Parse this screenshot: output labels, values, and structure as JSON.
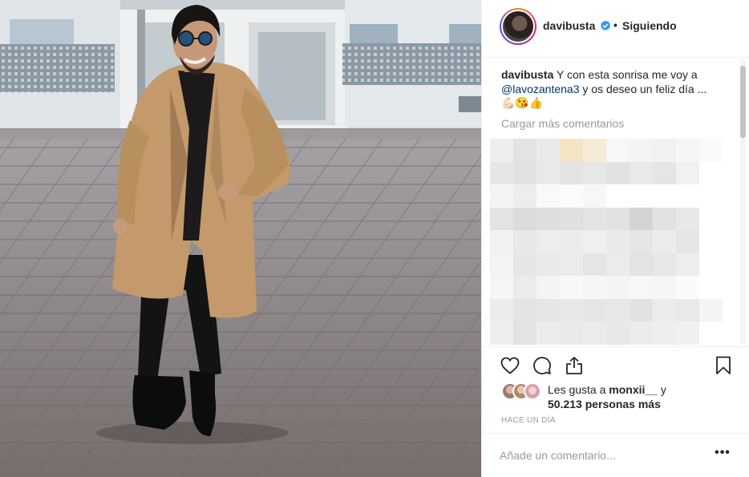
{
  "post": {
    "username": "davibusta",
    "follow_status": "Siguiendo",
    "separator": "•",
    "caption": {
      "user": "davibusta",
      "text_before": "Y con esta sonrisa me voy a",
      "mention": "@lavozantena3",
      "text_after": "y os deseo un feliz día ...",
      "emojis": "💪🏻😘👍"
    },
    "load_more_comments": "Cargar más comentarios",
    "likes": {
      "prefix": "Les gusta a",
      "user": "monxii__",
      "connector": "y",
      "others": "50.213 personas más"
    },
    "timestamp": "HACE UN DÍA",
    "comment_placeholder": "Añade un comentario...",
    "more_options": "•••"
  },
  "icons": {
    "verified": "verified-badge-icon",
    "like": "heart-icon",
    "comment": "comment-bubble-icon",
    "share": "share-icon",
    "save": "bookmark-icon",
    "options": "ellipsis-icon"
  },
  "colors": {
    "verified": "#3897f0",
    "text": "#262626",
    "muted": "#999999",
    "mention": "#003569",
    "border": "#efefef",
    "coat": "#c49a6c"
  }
}
